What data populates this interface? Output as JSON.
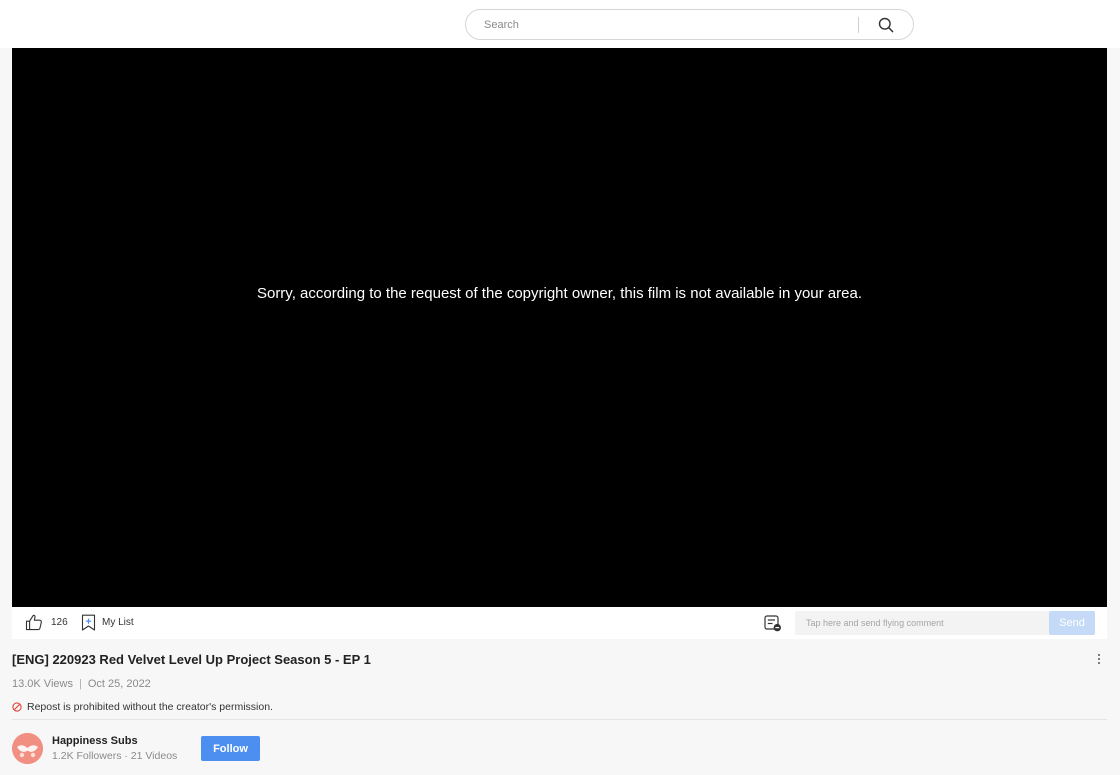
{
  "search": {
    "placeholder": "Search",
    "value": ""
  },
  "player": {
    "message": "Sorry, according to the request of the copyright owner, this film is not available in your area."
  },
  "actions": {
    "like_count": "126",
    "mylist_label": "My List",
    "comment_placeholder": "Tap here and send flying comment",
    "send_label": "Send"
  },
  "video": {
    "title": "[ENG] 220923 Red Velvet Level Up Project Season 5 - EP 1",
    "views": "13.0K Views",
    "separator": "|",
    "date": "Oct 25, 2022",
    "notice": "Repost is prohibited without the creator's permission."
  },
  "channel": {
    "name": "Happiness Subs",
    "stats": "1.2K Followers · 21 Videos",
    "follow_label": "Follow"
  },
  "colors": {
    "accent": "#4c8ff0",
    "send_disabled": "#c4daf7",
    "notice_icon": "#e0463c",
    "avatar_bg": "#f08f82"
  },
  "icons": [
    "search-icon",
    "thumbs-up-icon",
    "bookmark-add-icon",
    "danmaku-toggle-icon",
    "prohibited-icon",
    "more-vertical-icon"
  ]
}
